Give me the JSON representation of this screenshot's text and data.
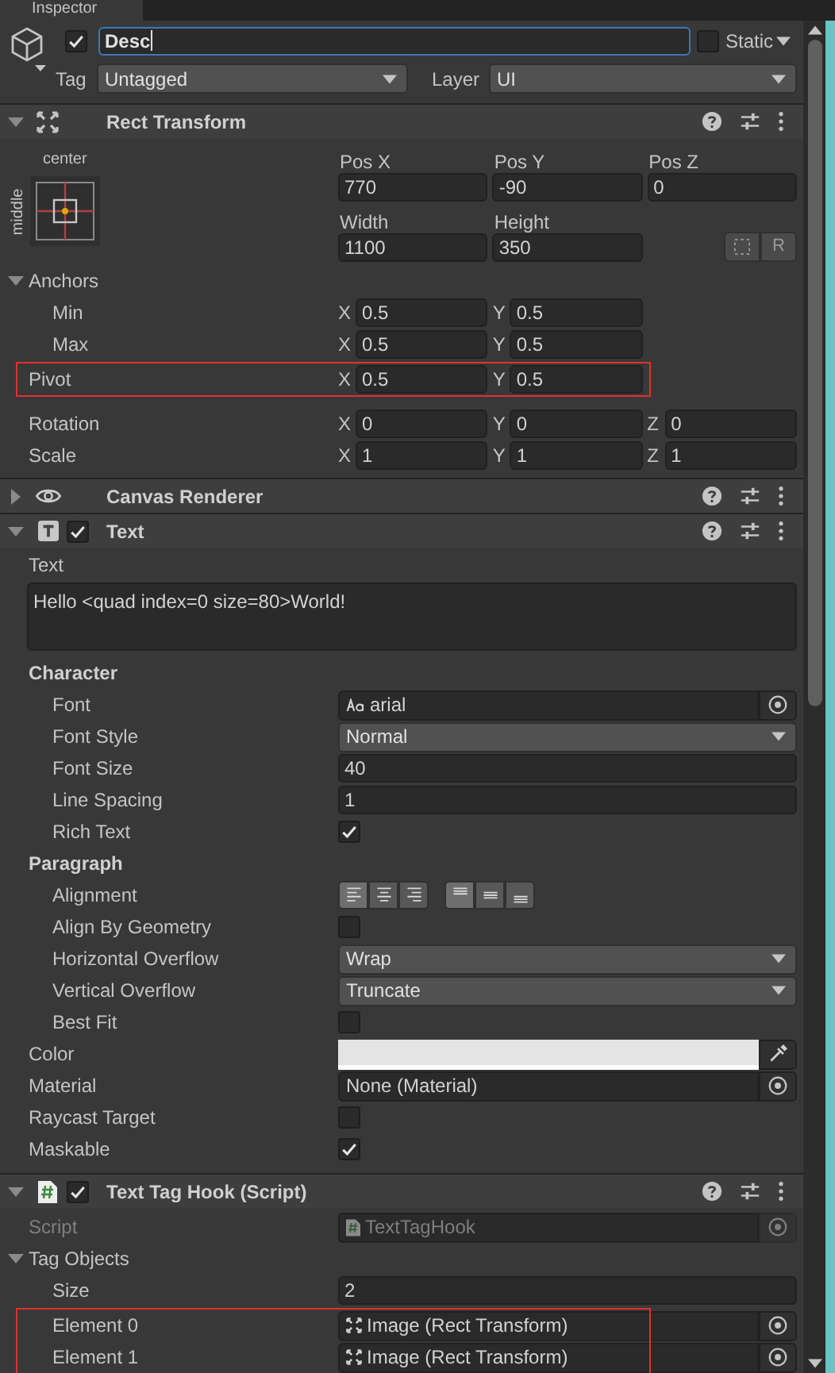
{
  "tab": {
    "title": "Inspector"
  },
  "object": {
    "active": true,
    "name": "Desc",
    "static": false,
    "static_label": "Static",
    "tag_label": "Tag",
    "tag": "Untagged",
    "layer_label": "Layer",
    "layer": "UI"
  },
  "components": [
    {
      "kind": "rect_transform",
      "title": "Rect Transform",
      "expanded": true,
      "anchor_preset": {
        "horizontal": "center",
        "vertical": "middle"
      },
      "position_fields": [
        {
          "label": "Pos X",
          "value": "770"
        },
        {
          "label": "Pos Y",
          "value": "-90"
        },
        {
          "label": "Pos Z",
          "value": "0"
        },
        {
          "label": "Width",
          "value": "1100"
        },
        {
          "label": "Height",
          "value": "350"
        }
      ],
      "raw_button": "R",
      "rows": [
        {
          "kind": "foldout",
          "label": "Anchors",
          "expanded": true,
          "children": [
            {
              "kind": "vector",
              "label": "Min",
              "fields": [
                {
                  "axis": "X",
                  "value": "0.5"
                },
                {
                  "axis": "Y",
                  "value": "0.5"
                }
              ]
            },
            {
              "kind": "vector",
              "label": "Max",
              "fields": [
                {
                  "axis": "X",
                  "value": "0.5"
                },
                {
                  "axis": "Y",
                  "value": "0.5"
                }
              ]
            }
          ]
        },
        {
          "kind": "vector",
          "label": "Pivot",
          "highlighted": true,
          "fields": [
            {
              "axis": "X",
              "value": "0.5"
            },
            {
              "axis": "Y",
              "value": "0.5"
            }
          ]
        },
        {
          "kind": "vector",
          "label": "Rotation",
          "fields": [
            {
              "axis": "X",
              "value": "0"
            },
            {
              "axis": "Y",
              "value": "0"
            },
            {
              "axis": "Z",
              "value": "0"
            }
          ]
        },
        {
          "kind": "vector",
          "label": "Scale",
          "fields": [
            {
              "axis": "X",
              "value": "1"
            },
            {
              "axis": "Y",
              "value": "1"
            },
            {
              "axis": "Z",
              "value": "1"
            }
          ]
        }
      ]
    },
    {
      "kind": "canvas_renderer",
      "title": "Canvas Renderer",
      "expanded": false
    },
    {
      "kind": "text",
      "title": "Text",
      "expanded": true,
      "enabled": true,
      "rows": [
        {
          "kind": "textarea",
          "label": "Text",
          "value": "Hello <quad index=0 size=80>World!"
        },
        {
          "kind": "heading",
          "label": "Character",
          "children": [
            {
              "kind": "font_object",
              "label": "Font",
              "value": "arial"
            },
            {
              "kind": "dropdown",
              "label": "Font Style",
              "value": "Normal"
            },
            {
              "kind": "field",
              "label": "Font Size",
              "value": "40"
            },
            {
              "kind": "field",
              "label": "Line Spacing",
              "value": "1"
            },
            {
              "kind": "checkbox",
              "label": "Rich Text",
              "checked": true
            }
          ]
        },
        {
          "kind": "heading",
          "label": "Paragraph",
          "children": [
            {
              "kind": "alignment",
              "label": "Alignment",
              "horizontal": [
                {
                  "selected": true
                },
                {
                  "selected": false
                },
                {
                  "selected": false
                }
              ],
              "vertical": [
                {
                  "selected": true
                },
                {
                  "selected": false
                },
                {
                  "selected": false
                }
              ]
            },
            {
              "kind": "checkbox",
              "label": "Align By Geometry",
              "checked": false
            },
            {
              "kind": "dropdown",
              "label": "Horizontal Overflow",
              "value": "Wrap"
            },
            {
              "kind": "dropdown",
              "label": "Vertical Overflow",
              "value": "Truncate"
            },
            {
              "kind": "checkbox",
              "label": "Best Fit",
              "checked": false
            }
          ]
        },
        {
          "kind": "color",
          "label": "Color",
          "color": "#e4e4e4"
        },
        {
          "kind": "object",
          "label": "Material",
          "value": "None (Material)"
        },
        {
          "kind": "checkbox",
          "label": "Raycast Target",
          "checked": false
        },
        {
          "kind": "checkbox",
          "label": "Maskable",
          "checked": true
        }
      ]
    },
    {
      "kind": "script",
      "title": "Text Tag Hook (Script)",
      "expanded": true,
      "enabled": true,
      "rows": [
        {
          "kind": "script_object",
          "label": "Script",
          "value": "TextTagHook",
          "disabled": true
        },
        {
          "kind": "foldout",
          "label": "Tag Objects",
          "expanded": true,
          "children": [
            {
              "kind": "field",
              "label": "Size",
              "value": "2"
            },
            {
              "kind": "transform_object",
              "label": "Element 0",
              "value": "Image (Rect Transform)",
              "highlighted": true
            },
            {
              "kind": "transform_object",
              "label": "Element 1",
              "value": "Image (Rect Transform)",
              "highlighted": true
            }
          ]
        }
      ]
    }
  ]
}
